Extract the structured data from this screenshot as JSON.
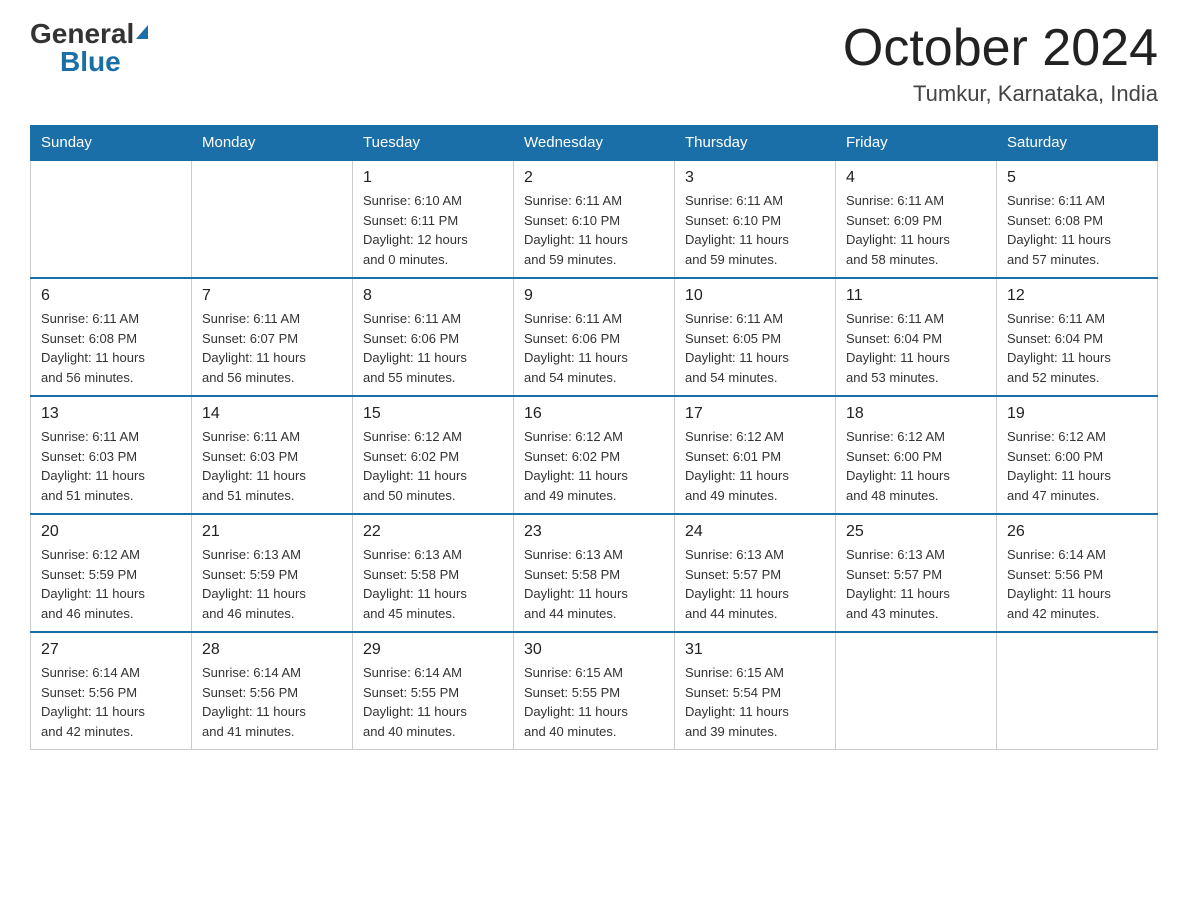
{
  "logo": {
    "general": "General",
    "blue": "Blue"
  },
  "title": "October 2024",
  "location": "Tumkur, Karnataka, India",
  "days_header": [
    "Sunday",
    "Monday",
    "Tuesday",
    "Wednesday",
    "Thursday",
    "Friday",
    "Saturday"
  ],
  "weeks": [
    [
      {
        "day": "",
        "info": ""
      },
      {
        "day": "",
        "info": ""
      },
      {
        "day": "1",
        "info": "Sunrise: 6:10 AM\nSunset: 6:11 PM\nDaylight: 12 hours\nand 0 minutes."
      },
      {
        "day": "2",
        "info": "Sunrise: 6:11 AM\nSunset: 6:10 PM\nDaylight: 11 hours\nand 59 minutes."
      },
      {
        "day": "3",
        "info": "Sunrise: 6:11 AM\nSunset: 6:10 PM\nDaylight: 11 hours\nand 59 minutes."
      },
      {
        "day": "4",
        "info": "Sunrise: 6:11 AM\nSunset: 6:09 PM\nDaylight: 11 hours\nand 58 minutes."
      },
      {
        "day": "5",
        "info": "Sunrise: 6:11 AM\nSunset: 6:08 PM\nDaylight: 11 hours\nand 57 minutes."
      }
    ],
    [
      {
        "day": "6",
        "info": "Sunrise: 6:11 AM\nSunset: 6:08 PM\nDaylight: 11 hours\nand 56 minutes."
      },
      {
        "day": "7",
        "info": "Sunrise: 6:11 AM\nSunset: 6:07 PM\nDaylight: 11 hours\nand 56 minutes."
      },
      {
        "day": "8",
        "info": "Sunrise: 6:11 AM\nSunset: 6:06 PM\nDaylight: 11 hours\nand 55 minutes."
      },
      {
        "day": "9",
        "info": "Sunrise: 6:11 AM\nSunset: 6:06 PM\nDaylight: 11 hours\nand 54 minutes."
      },
      {
        "day": "10",
        "info": "Sunrise: 6:11 AM\nSunset: 6:05 PM\nDaylight: 11 hours\nand 54 minutes."
      },
      {
        "day": "11",
        "info": "Sunrise: 6:11 AM\nSunset: 6:04 PM\nDaylight: 11 hours\nand 53 minutes."
      },
      {
        "day": "12",
        "info": "Sunrise: 6:11 AM\nSunset: 6:04 PM\nDaylight: 11 hours\nand 52 minutes."
      }
    ],
    [
      {
        "day": "13",
        "info": "Sunrise: 6:11 AM\nSunset: 6:03 PM\nDaylight: 11 hours\nand 51 minutes."
      },
      {
        "day": "14",
        "info": "Sunrise: 6:11 AM\nSunset: 6:03 PM\nDaylight: 11 hours\nand 51 minutes."
      },
      {
        "day": "15",
        "info": "Sunrise: 6:12 AM\nSunset: 6:02 PM\nDaylight: 11 hours\nand 50 minutes."
      },
      {
        "day": "16",
        "info": "Sunrise: 6:12 AM\nSunset: 6:02 PM\nDaylight: 11 hours\nand 49 minutes."
      },
      {
        "day": "17",
        "info": "Sunrise: 6:12 AM\nSunset: 6:01 PM\nDaylight: 11 hours\nand 49 minutes."
      },
      {
        "day": "18",
        "info": "Sunrise: 6:12 AM\nSunset: 6:00 PM\nDaylight: 11 hours\nand 48 minutes."
      },
      {
        "day": "19",
        "info": "Sunrise: 6:12 AM\nSunset: 6:00 PM\nDaylight: 11 hours\nand 47 minutes."
      }
    ],
    [
      {
        "day": "20",
        "info": "Sunrise: 6:12 AM\nSunset: 5:59 PM\nDaylight: 11 hours\nand 46 minutes."
      },
      {
        "day": "21",
        "info": "Sunrise: 6:13 AM\nSunset: 5:59 PM\nDaylight: 11 hours\nand 46 minutes."
      },
      {
        "day": "22",
        "info": "Sunrise: 6:13 AM\nSunset: 5:58 PM\nDaylight: 11 hours\nand 45 minutes."
      },
      {
        "day": "23",
        "info": "Sunrise: 6:13 AM\nSunset: 5:58 PM\nDaylight: 11 hours\nand 44 minutes."
      },
      {
        "day": "24",
        "info": "Sunrise: 6:13 AM\nSunset: 5:57 PM\nDaylight: 11 hours\nand 44 minutes."
      },
      {
        "day": "25",
        "info": "Sunrise: 6:13 AM\nSunset: 5:57 PM\nDaylight: 11 hours\nand 43 minutes."
      },
      {
        "day": "26",
        "info": "Sunrise: 6:14 AM\nSunset: 5:56 PM\nDaylight: 11 hours\nand 42 minutes."
      }
    ],
    [
      {
        "day": "27",
        "info": "Sunrise: 6:14 AM\nSunset: 5:56 PM\nDaylight: 11 hours\nand 42 minutes."
      },
      {
        "day": "28",
        "info": "Sunrise: 6:14 AM\nSunset: 5:56 PM\nDaylight: 11 hours\nand 41 minutes."
      },
      {
        "day": "29",
        "info": "Sunrise: 6:14 AM\nSunset: 5:55 PM\nDaylight: 11 hours\nand 40 minutes."
      },
      {
        "day": "30",
        "info": "Sunrise: 6:15 AM\nSunset: 5:55 PM\nDaylight: 11 hours\nand 40 minutes."
      },
      {
        "day": "31",
        "info": "Sunrise: 6:15 AM\nSunset: 5:54 PM\nDaylight: 11 hours\nand 39 minutes."
      },
      {
        "day": "",
        "info": ""
      },
      {
        "day": "",
        "info": ""
      }
    ]
  ]
}
